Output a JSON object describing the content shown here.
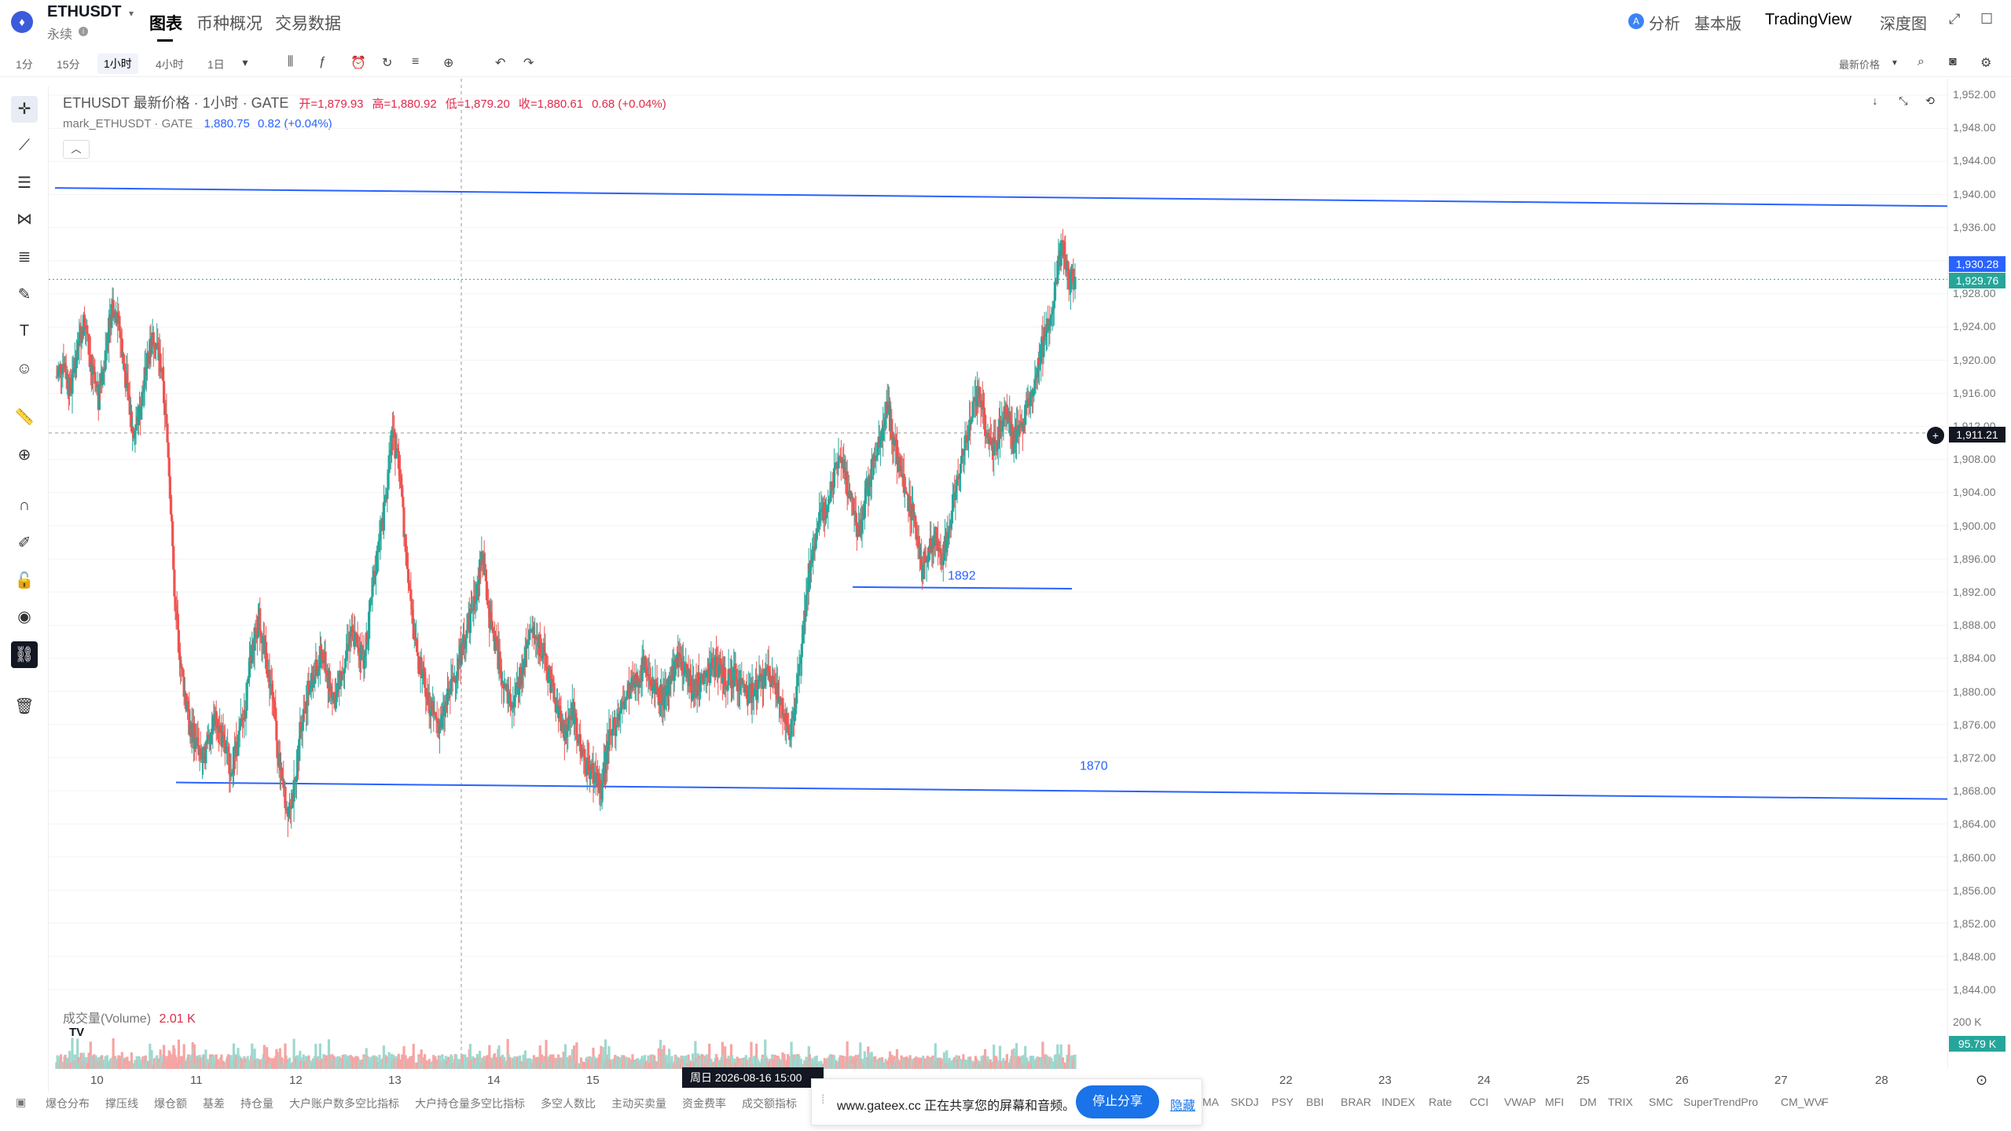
{
  "header": {
    "symbol": "ETHUSDT",
    "contract_type": "永续",
    "tabs": [
      "图表",
      "币种概况",
      "交易数据"
    ],
    "right_links": [
      "分析",
      "基本版",
      "TradingView",
      "深度图"
    ]
  },
  "timeframes": [
    "1分",
    "15分",
    "1小时",
    "4小时",
    "1日"
  ],
  "selected_timeframe": "1小时",
  "price_source": "最新价格",
  "legend": {
    "main_title": "ETHUSDT 最新价格 · 1小时 · GATE",
    "open": "开=1,879.93",
    "high": "高=1,880.92",
    "low": "低=1,879.20",
    "close": "收=1,880.61",
    "change": "0.68 (+0.04%)",
    "mark_title": "mark_ETHUSDT · GATE",
    "mark_price": "1,880.75",
    "mark_change": "0.82 (+0.04%)"
  },
  "volume_legend": {
    "label": "成交量(Volume)",
    "value": "2.01 K"
  },
  "price_axis": [
    "1,952.00",
    "1,948.00",
    "1,944.00",
    "1,940.00",
    "1,936.00",
    "1,932.00",
    "1,928.00",
    "1,924.00",
    "1,920.00",
    "1,916.00",
    "1,912.00",
    "1,908.00",
    "1,904.00",
    "1,900.00",
    "1,896.00",
    "1,892.00",
    "1,888.00",
    "1,884.00",
    "1,880.00",
    "1,876.00",
    "1,872.00",
    "1,868.00",
    "1,864.00",
    "1,860.00",
    "1,856.00",
    "1,852.00",
    "1,848.00",
    "1,844.00"
  ],
  "price_tags": {
    "mark": "1,930.28",
    "last": "1,929.76",
    "crosshair": "1,911.21"
  },
  "volume_axis": {
    "top": "200 K",
    "tag": "95.79 K"
  },
  "time_axis": [
    "10",
    "11",
    "12",
    "13",
    "14",
    "15",
    "22",
    "23",
    "24",
    "25",
    "26",
    "27",
    "28"
  ],
  "crosshair_time": "周日 2026-08-16   15:00",
  "drawings": {
    "line_label_1892": "1892",
    "line_label_1870": "1870"
  },
  "bottom_indicators_left": [
    "爆仓分布",
    "撑压线",
    "爆仓额",
    "基差",
    "持仓量",
    "大户账户数多空比指标",
    "大户持仓量多空比指标",
    "多空人数比",
    "主动买卖量",
    "资金费率",
    "成交额指标"
  ],
  "bottom_indicators_right": [
    "MA",
    "SKDJ",
    "PSY",
    "BBI",
    "BRAR",
    "INDEX",
    "Rate",
    "CCI",
    "VWAP",
    "MFI",
    "DM",
    "TRIX",
    "SMC",
    "SuperTrendPro",
    "CM_WVF"
  ],
  "share_bar": {
    "text": "www.gateex.cc 正在共享您的屏幕和音频。",
    "stop": "停止分享",
    "hide": "隐藏"
  },
  "colors": {
    "up": "#26a69a",
    "down": "#ef5350",
    "drawing": "#2962ff",
    "mark_tag": "#2962ff",
    "last_tag": "#26a69a"
  },
  "chart_data": {
    "type": "candlestick",
    "price_range": [
      1842,
      1954
    ],
    "horizontal_lines": [
      1892,
      1870
    ],
    "close_series": [
      1918,
      1920,
      1916,
      1922,
      1925,
      1919,
      1915,
      1921,
      1926,
      1924,
      1917,
      1911,
      1914,
      1920,
      1923,
      1919,
      1909,
      1890,
      1882,
      1876,
      1874,
      1872,
      1875,
      1877,
      1873,
      1871,
      1874,
      1878,
      1885,
      1889,
      1884,
      1879,
      1870,
      1866,
      1868,
      1876,
      1880,
      1882,
      1885,
      1881,
      1879,
      1883,
      1887,
      1886,
      1884,
      1890,
      1897,
      1902,
      1911,
      1908,
      1897,
      1888,
      1883,
      1880,
      1877,
      1876,
      1879,
      1882,
      1885,
      1888,
      1892,
      1896,
      1889,
      1885,
      1881,
      1878,
      1880,
      1884,
      1887,
      1886,
      1884,
      1880,
      1877,
      1875,
      1878,
      1873,
      1871,
      1870,
      1868,
      1874,
      1876,
      1878,
      1880,
      1881,
      1883,
      1882,
      1880,
      1879,
      1882,
      1884,
      1883,
      1880,
      1881,
      1882,
      1883,
      1883,
      1881,
      1882,
      1881,
      1880,
      1880,
      1881,
      1882,
      1881,
      1878,
      1874,
      1880,
      1888,
      1896,
      1900,
      1902,
      1905,
      1908,
      1906,
      1902,
      1899,
      1904,
      1908,
      1911,
      1914,
      1910,
      1906,
      1903,
      1900,
      1895,
      1897,
      1899,
      1896,
      1901,
      1905,
      1909,
      1914,
      1916,
      1912,
      1909,
      1911,
      1914,
      1910,
      1912,
      1914,
      1918,
      1921,
      1924,
      1929,
      1934,
      1930
    ]
  }
}
